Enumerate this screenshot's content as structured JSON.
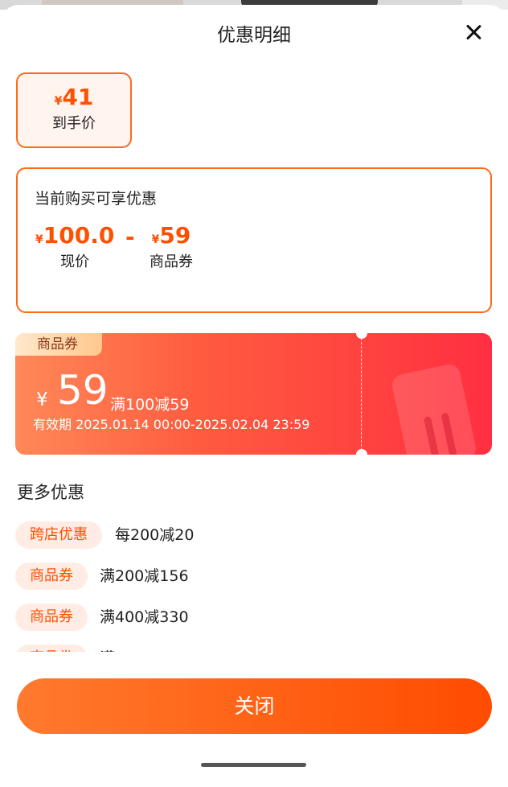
{
  "header": {
    "title": "优惠明细",
    "close_icon": "close-icon"
  },
  "final_price": {
    "currency": "¥",
    "amount": "41",
    "label": "到手价"
  },
  "current_offer": {
    "title": "当前购买可享优惠",
    "current_price": {
      "currency": "¥",
      "amount": "100.0",
      "label": "现价"
    },
    "operator": "-",
    "coupon": {
      "currency": "¥",
      "amount": "59",
      "label": "商品券"
    }
  },
  "coupon_card": {
    "tag": "商品券",
    "currency": "¥",
    "amount": "59",
    "condition": "满100减59",
    "validity": "有效期 2025.01.14 00:00-2025.02.04 23:59",
    "colors": {
      "start": "#ff8858",
      "end": "#ff2f41"
    }
  },
  "more_offers": {
    "title": "更多优惠",
    "items": [
      {
        "tag": "跨店优惠",
        "text": "每200减20"
      },
      {
        "tag": "商品券",
        "text": "满200减156"
      },
      {
        "tag": "商品券",
        "text": "满400减330"
      },
      {
        "tag": "商品券",
        "text": "满"
      }
    ]
  },
  "footer": {
    "button_label": "关闭"
  },
  "colors": {
    "accent": "#ff5000",
    "border": "#ff6a1a"
  }
}
